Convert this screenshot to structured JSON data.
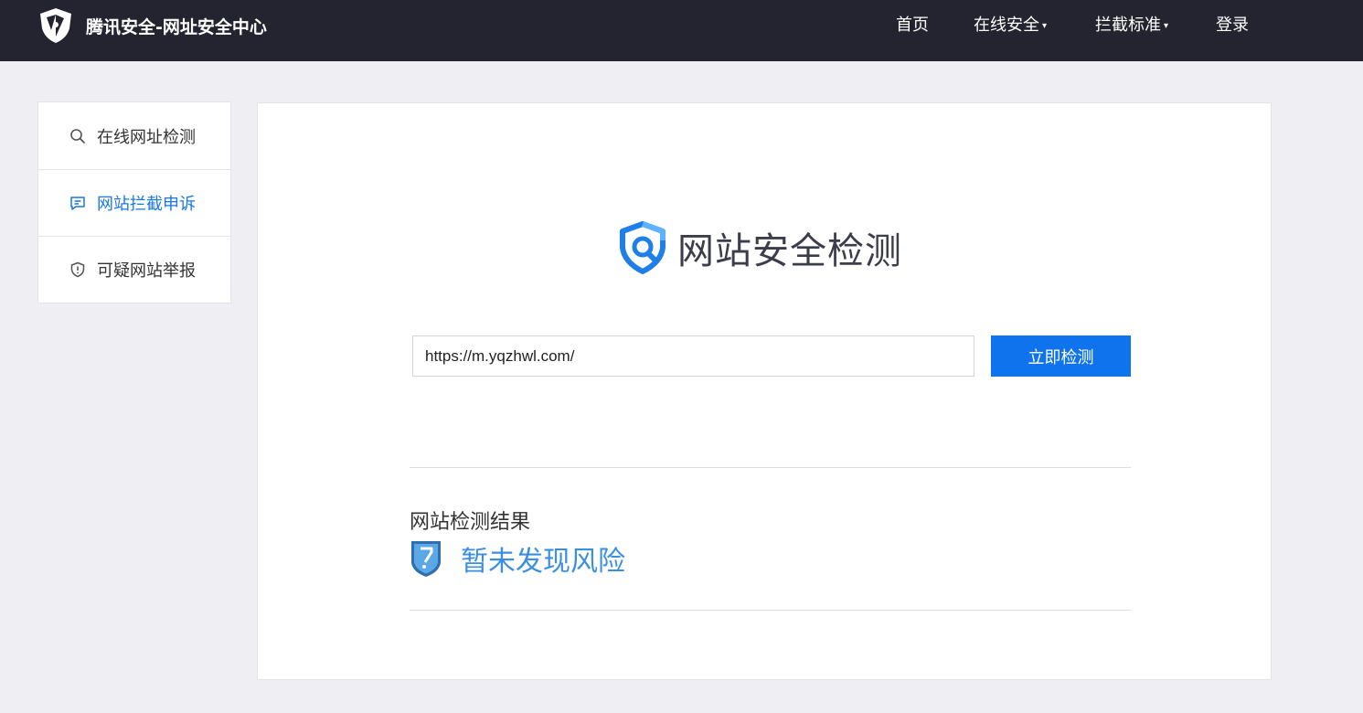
{
  "header": {
    "brand_title": "腾讯安全-网址安全中心",
    "nav": [
      {
        "label": "首页",
        "has_dropdown": false
      },
      {
        "label": "在线安全",
        "has_dropdown": true
      },
      {
        "label": "拦截标准",
        "has_dropdown": true
      },
      {
        "label": "登录",
        "has_dropdown": false
      }
    ],
    "caret": "▾"
  },
  "sidebar": {
    "items": [
      {
        "label": "在线网址检测",
        "icon": "search-icon",
        "active": false
      },
      {
        "label": "网站拦截申诉",
        "icon": "chat-bubble-icon",
        "active": true
      },
      {
        "label": "可疑网站举报",
        "icon": "shield-alert-icon",
        "active": false
      }
    ]
  },
  "main": {
    "title": "网站安全检测",
    "url_value": "https://m.yqzhwl.com/",
    "check_button": "立即检测",
    "result_label": "网站检测结果",
    "result_status": "暂未发现风险"
  },
  "colors": {
    "topbar": "#23242f",
    "accent": "#0f73ee",
    "active_link": "#1677e5",
    "result_text": "#3a8fe0",
    "page_bg": "#efeff3"
  }
}
